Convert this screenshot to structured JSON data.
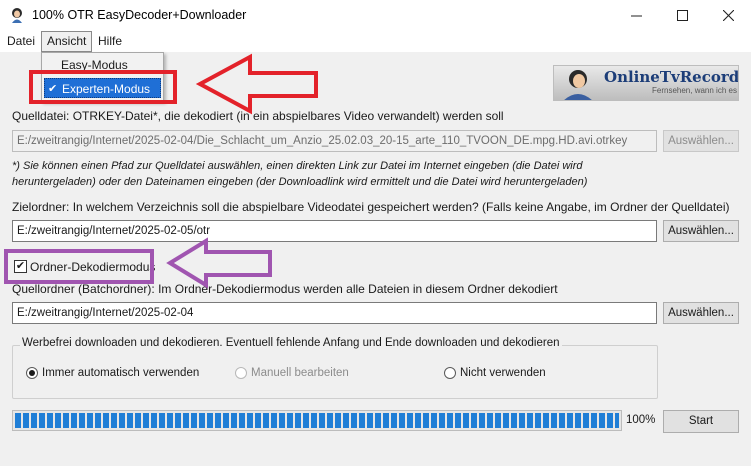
{
  "window": {
    "title": "100% OTR EasyDecoder+Downloader",
    "controls": [
      "minimize-icon",
      "maximize-icon",
      "close-icon"
    ]
  },
  "menubar": {
    "items": [
      {
        "label": "Datei"
      },
      {
        "label": "Ansicht",
        "active": true
      },
      {
        "label": "Hilfe"
      }
    ]
  },
  "view_menu": {
    "items": [
      {
        "label": "Easy-Modus",
        "checked": false
      },
      {
        "label": "Experten-Modus",
        "checked": true
      }
    ]
  },
  "logo": {
    "text": "OnlineTvRecorder.com",
    "tagline": "Fernsehen, wann ich es will"
  },
  "source": {
    "label": "Quelldatei: OTRKEY-Datei*, die dekodiert (in ein abspielbares Video verwandelt) werden soll",
    "value": "E:/zweitrangig/Internet/2025-02-04/Die_Schlacht_um_Anzio_25.02.03_20-15_arte_110_TVOON_DE.mpg.HD.avi.otrkey",
    "button": "Auswählen...",
    "enabled": false,
    "note": "*) Sie können einen Pfad zur Quelldatei auswählen, einen direkten Link zur Datei im Internet eingeben (die Datei wird heruntergeladen) oder den Dateinamen eingeben (der Downloadlink wird ermittelt und die Datei wird heruntergeladen)"
  },
  "target": {
    "label": "Zielordner: In welchem Verzeichnis soll die abspielbare Videodatei gespeichert werden? (Falls keine Angabe, im Ordner der Quelldatei)",
    "value": "E:/zweitrangig/Internet/2025-02-05/otr",
    "button": "Auswählen..."
  },
  "folder_mode": {
    "label": "Ordner-Dekodiermodus",
    "checked": true
  },
  "source_folder": {
    "label": "Quellordner (Batchordner): Im Ordner-Dekodiermodus werden alle Dateien in diesem Ordner dekodiert",
    "value": "E:/zweitrangig/Internet/2025-02-04",
    "button": "Auswählen..."
  },
  "adfree": {
    "title": "Werbefrei downloaden und dekodieren. Eventuell fehlende Anfang und Ende downloaden und dekodieren",
    "options": [
      {
        "label": "Immer automatisch verwenden",
        "checked": true,
        "enabled": true
      },
      {
        "label": "Manuell bearbeiten",
        "checked": false,
        "enabled": false
      },
      {
        "label": "Nicht verwenden",
        "checked": false,
        "enabled": true
      }
    ]
  },
  "progress": {
    "value": 100,
    "text": "100%"
  },
  "start_button": "Start",
  "annotation_colors": {
    "red": "#e3222a",
    "purple": "#a055b0"
  }
}
